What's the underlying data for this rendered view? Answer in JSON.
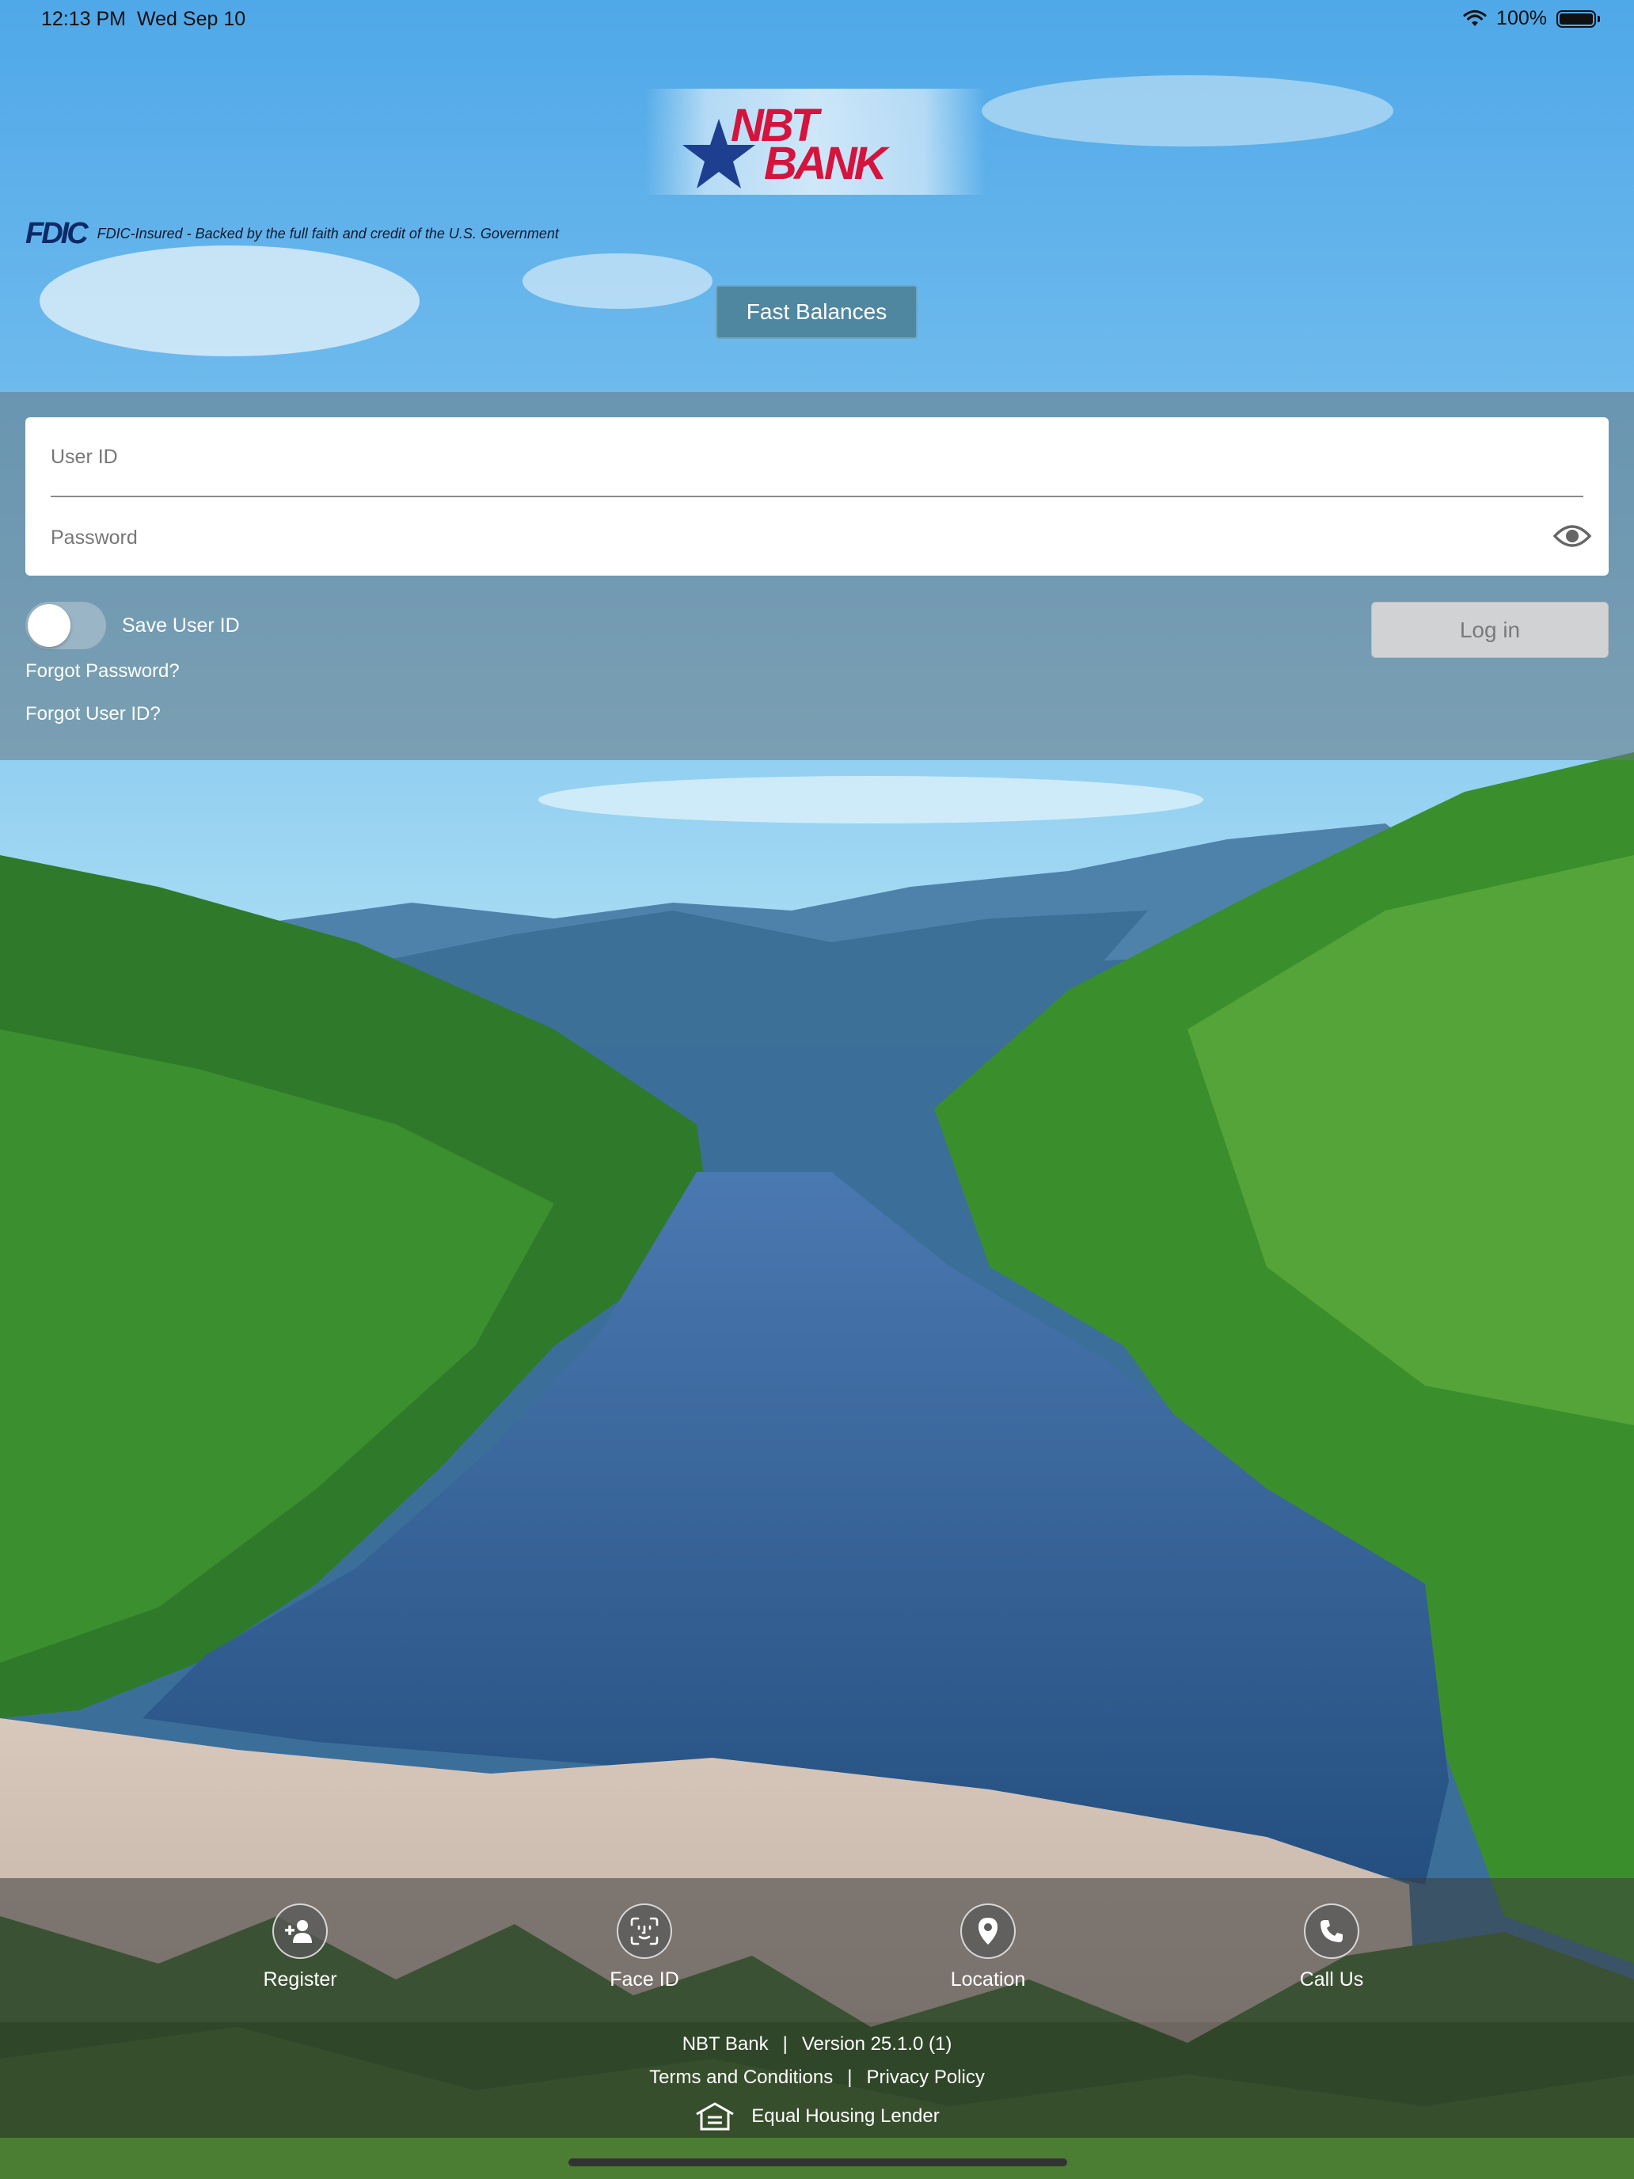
{
  "status_bar": {
    "time": "12:13 PM",
    "date": "Wed Sep 10",
    "battery_percent": "100%"
  },
  "brand": {
    "logo_line1": "NBT",
    "logo_line2": "BANK",
    "logo_color": "#d4143d",
    "star_color": "#1e3f8f"
  },
  "fdic": {
    "mark": "FDIC",
    "text": "FDIC-Insured - Backed by the full faith and credit of the U.S. Government"
  },
  "fast_balances": {
    "label": "Fast Balances"
  },
  "login": {
    "user_id_placeholder": "User ID",
    "password_placeholder": "Password",
    "save_user_id_label": "Save User ID",
    "save_user_id_on": false,
    "login_label": "Log in",
    "forgot_password": "Forgot Password?",
    "forgot_user_id": "Forgot User ID?"
  },
  "toolbar": {
    "items": [
      {
        "label": "Register",
        "icon": "add-user-icon"
      },
      {
        "label": "Face ID",
        "icon": "face-id-icon"
      },
      {
        "label": "Location",
        "icon": "location-pin-icon"
      },
      {
        "label": "Call Us",
        "icon": "phone-icon"
      }
    ]
  },
  "footer": {
    "bank_name": "NBT Bank",
    "separator": "|",
    "version": "Version 25.1.0 (1)",
    "terms": "Terms and Conditions",
    "privacy": "Privacy Policy",
    "equal_housing": "Equal Housing Lender"
  }
}
